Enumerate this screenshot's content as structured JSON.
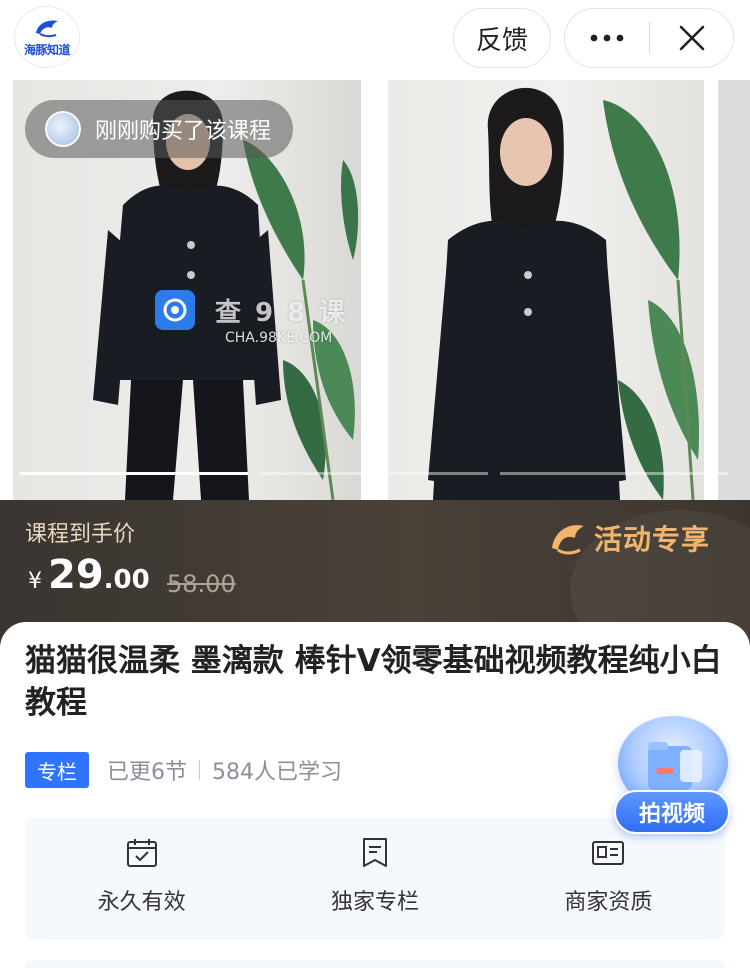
{
  "header": {
    "logo_text": "海豚知道",
    "feedback_label": "反馈",
    "more_icon": "more-dots-icon",
    "close_icon": "close-icon"
  },
  "banner": {
    "buyer_notice": "刚刚购买了该课程",
    "watermark_cn": "查98课",
    "watermark_en": "CHA.98KE.COM",
    "active_slide": 1,
    "slide_count": 3
  },
  "price": {
    "label": "课程到手价",
    "currency": "¥",
    "integer": "29",
    "decimal": ".00",
    "original": "58.00",
    "promo_text": "活动专享"
  },
  "course": {
    "title": "猫猫很温柔 墨漓款 棒针V领零基础视频教程纯小白教程",
    "tag": "专栏",
    "updates": "已更6节",
    "learners": "584人已学习"
  },
  "features": [
    {
      "icon": "calendar-check-icon",
      "label": "永久有效"
    },
    {
      "icon": "bookmark-list-icon",
      "label": "独家专栏"
    },
    {
      "icon": "id-card-icon",
      "label": "商家资质"
    }
  ],
  "float_button": {
    "label": "拍视频"
  },
  "colors": {
    "brand_blue": "#2e74ff",
    "price_strip_bg": "#3a3531",
    "promo_gold": "#f3b56b"
  }
}
